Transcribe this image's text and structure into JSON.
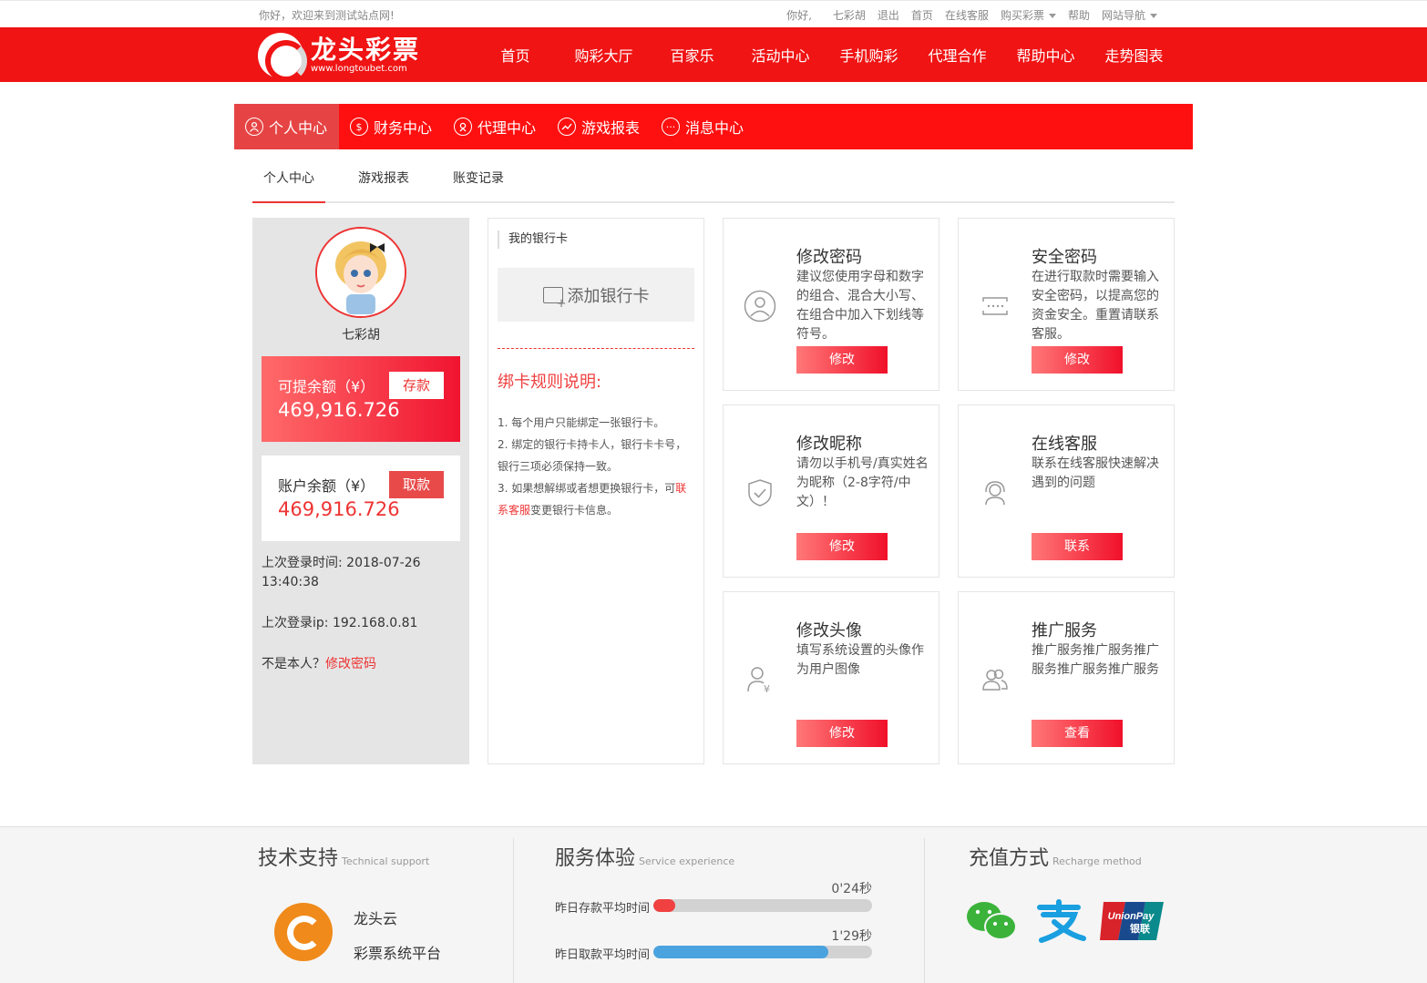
{
  "topbar": {
    "welcome": "你好，欢迎来到测试站点网!",
    "greeting": "你好,",
    "username": "七彩胡",
    "logout": "退出",
    "home": "首页",
    "service": "在线客服",
    "buy": "购买彩票",
    "help": "帮助",
    "sitenav": "网站导航"
  },
  "header": {
    "logo_cn": "龙头彩票",
    "logo_url": "www.longtoubet.com",
    "nav": [
      "首页",
      "购彩大厅",
      "百家乐",
      "活动中心",
      "手机购彩",
      "代理合作",
      "帮助中心",
      "走势图表"
    ]
  },
  "user_tabs": [
    "个人中心",
    "财务中心",
    "代理中心",
    "游戏报表",
    "消息中心"
  ],
  "sub_tabs": [
    "个人中心",
    "游戏报表",
    "账变记录"
  ],
  "profile": {
    "name": "七彩胡",
    "withdrawable_label": "可提余额（¥）",
    "withdrawable_value": "469,916.726",
    "deposit_btn": "存款",
    "account_label": "账户余额（¥）",
    "account_value": "469,916.726",
    "withdraw_btn": "取款",
    "last_login_label": "上次登录时间:",
    "last_login_value": "2018-07-26 13:40:38",
    "last_ip_label": "上次登录ip:",
    "last_ip_value": "192.168.0.81",
    "not_me": "不是本人？",
    "change_pwd": "修改密码"
  },
  "bank": {
    "title": "我的银行卡",
    "add": "添加银行卡",
    "rules_title": "绑卡规则说明:",
    "rule1": "1. 每个用户只能绑定一张银行卡。",
    "rule2": "2. 绑定的银行卡持卡人，银行卡卡号，银行三项必须保持一致。",
    "rule3a": "3. 如果想解绑或者想更换银行卡，可",
    "rule3link": "联系客服",
    "rule3b": "变更银行卡信息。"
  },
  "cards": [
    {
      "title": "修改密码",
      "desc": "建议您使用字母和数字的组合、混合大小写、在组合中加入下划线等符号。",
      "btn": "修改",
      "icon": "user-icon"
    },
    {
      "title": "安全密码",
      "desc": "在进行取款时需要输入安全密码，以提高您的资金安全。重置请联系客服。",
      "btn": "修改",
      "icon": "password-field-icon"
    },
    {
      "title": "修改昵称",
      "desc": "请勿以手机号/真实姓名为昵称（2-8字符/中文）！",
      "btn": "修改",
      "icon": "shield-check-icon"
    },
    {
      "title": "在线客服",
      "desc": "联系在线客服快速解决遇到的问题",
      "btn": "联系",
      "icon": "headset-icon"
    },
    {
      "title": "修改头像",
      "desc": "填写系统设置的头像作为用户图像",
      "btn": "修改",
      "icon": "user-yen-icon"
    },
    {
      "title": "推广服务",
      "desc": "推广服务推广服务推广服务推广服务推广服务",
      "btn": "查看",
      "icon": "users-icon"
    }
  ],
  "footer": {
    "tech_title": "技术支持",
    "tech_sub": "Technical support",
    "tech_name": "龙头云",
    "tech_desc": "彩票系统平台",
    "service_title": "服务体验",
    "service_sub": "Service experience",
    "deposit_label": "昨日存款平均时间",
    "deposit_value": "0'24秒",
    "deposit_progress": 0.1,
    "withdraw_label": "昨日取款平均时间",
    "withdraw_value": "1'29秒",
    "withdraw_progress": 0.8,
    "recharge_title": "充值方式",
    "recharge_sub": "Recharge method",
    "unionpay": "UnionPay",
    "unionpay_cn": "银联",
    "colors": {
      "deposit": "#f04040",
      "withdraw": "#4aa3df",
      "brand": "#f01414"
    }
  }
}
